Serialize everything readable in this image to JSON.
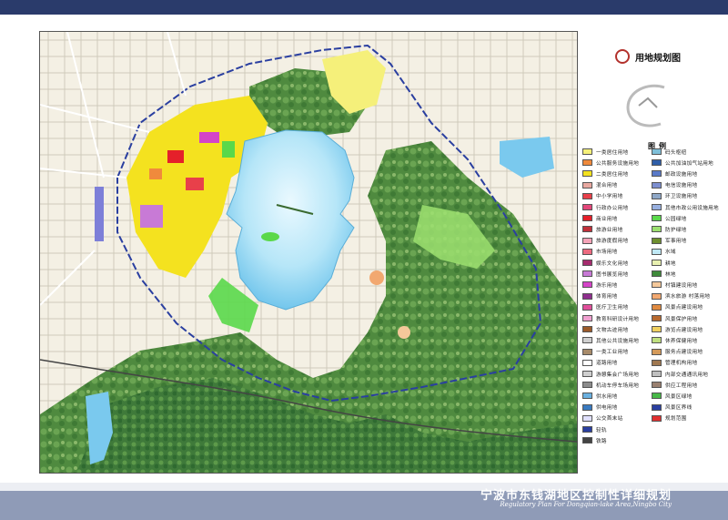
{
  "footer": {
    "title": "宁波市东钱湖地区控制性详细规划",
    "subtitle": "Regulatory Plan For Dongqian-lake Area,Ningbo City"
  },
  "legend": {
    "title": "用地规划图",
    "subtitle": "图例",
    "left": [
      {
        "label": "一类居住用地",
        "color": "#f5f07a"
      },
      {
        "label": "公共服务设施用地",
        "color": "#f08a3c"
      },
      {
        "label": "二类居住用地",
        "color": "#f4e21f"
      },
      {
        "label": "混合用地",
        "color": "#e8a8a0"
      },
      {
        "label": "中小学用地",
        "color": "#e8404a"
      },
      {
        "label": "行政办公用地",
        "color": "#e3477a"
      },
      {
        "label": "商业用地",
        "color": "#e5202a"
      },
      {
        "label": "旅游业用地",
        "color": "#c0303a"
      },
      {
        "label": "旅游度假用地",
        "color": "#f5a4b8"
      },
      {
        "label": "市场用地",
        "color": "#ec6b80"
      },
      {
        "label": "娱乐文化用地",
        "color": "#a52c6e"
      },
      {
        "label": "图书展览用地",
        "color": "#c87ad6"
      },
      {
        "label": "游乐用地",
        "color": "#d444c8"
      },
      {
        "label": "体育用地",
        "color": "#8f2f8e"
      },
      {
        "label": "医疗卫生用地",
        "color": "#e04e9a"
      },
      {
        "label": "教育科研设计用地",
        "color": "#f0a0d0"
      },
      {
        "label": "文物古迹用地",
        "color": "#9c5b2b"
      },
      {
        "label": "其他公共设施用地",
        "color": "#d0d0d0"
      },
      {
        "label": "一类工业用地",
        "color": "#a88b6a"
      },
      {
        "label": "道路用地",
        "color": "#ffffff"
      },
      {
        "label": "游憩集会广场用地",
        "color": "#cfcfcf"
      },
      {
        "label": "机动车停车场用地",
        "color": "#8c8c8c"
      },
      {
        "label": "供水用地",
        "color": "#6ab0e0"
      },
      {
        "label": "供电用地",
        "color": "#3a7ac0"
      },
      {
        "label": "公交首末站",
        "color": "#e0e0ff"
      },
      {
        "label": "轻轨",
        "color": "#2a3fa0"
      },
      {
        "label": "铁路",
        "color": "#444444"
      }
    ],
    "right": [
      {
        "label": "码头枢纽",
        "color": "#7fbfd8"
      },
      {
        "label": "公共加油加气站用地",
        "color": "#2f5ea8"
      },
      {
        "label": "邮政设施用地",
        "color": "#5a7ac8"
      },
      {
        "label": "电信设施用地",
        "color": "#7d8fd0"
      },
      {
        "label": "环卫设施用地",
        "color": "#8fa8c8"
      },
      {
        "label": "其他市政公用设施用地",
        "color": "#98b0e0"
      },
      {
        "label": "公园绿地",
        "color": "#5ad84a"
      },
      {
        "label": "防护绿地",
        "color": "#9ce070"
      },
      {
        "label": "军事用地",
        "color": "#6e8f2f"
      },
      {
        "label": "水域",
        "color": "#bfe8f5"
      },
      {
        "label": "耕地",
        "color": "#e8f0b0"
      },
      {
        "label": "林地",
        "color": "#3f8a3a"
      },
      {
        "label": "村镇建设用地",
        "color": "#f4c89a"
      },
      {
        "label": "滨水旅游 村落用地",
        "color": "#f2a870"
      },
      {
        "label": "风景点建设用地",
        "color": "#e08a40"
      },
      {
        "label": "风景保护用地",
        "color": "#b86a30"
      },
      {
        "label": "游览点建设用地",
        "color": "#f0d060"
      },
      {
        "label": "休养保健用地",
        "color": "#c0e080"
      },
      {
        "label": "服务点建设用地",
        "color": "#d49a5a"
      },
      {
        "label": "管理机构用地",
        "color": "#a07850"
      },
      {
        "label": "内部交通通讯用地",
        "color": "#c0c0c0"
      },
      {
        "label": "供应工程用地",
        "color": "#9a8070"
      },
      {
        "label": "风景区绿地",
        "color": "#48b848"
      },
      {
        "label": "风景区界线",
        "color": "#2a3fa0"
      },
      {
        "label": "规划范围",
        "color": "#e03030"
      }
    ]
  }
}
